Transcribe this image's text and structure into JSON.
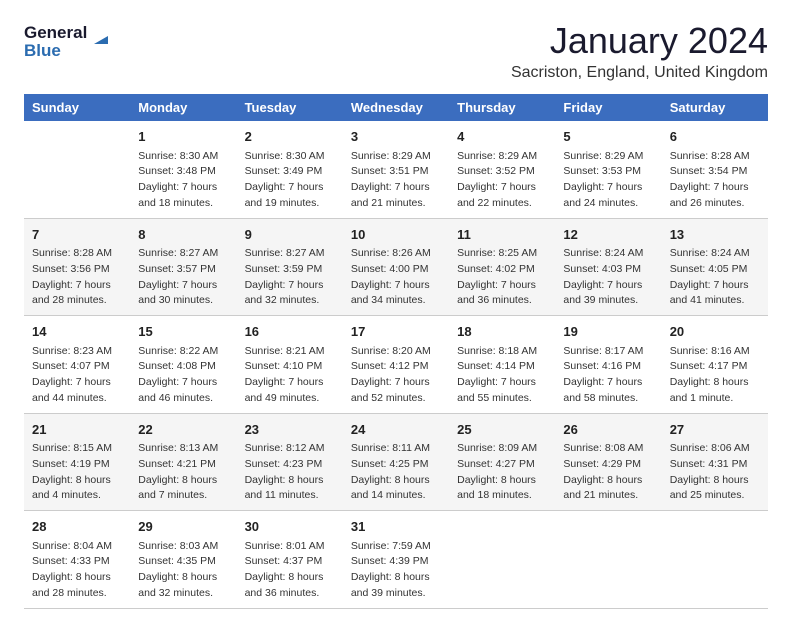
{
  "header": {
    "logo_line1": "General",
    "logo_line2": "Blue",
    "month": "January 2024",
    "location": "Sacriston, England, United Kingdom"
  },
  "weekdays": [
    "Sunday",
    "Monday",
    "Tuesday",
    "Wednesday",
    "Thursday",
    "Friday",
    "Saturday"
  ],
  "weeks": [
    [
      {
        "day": "",
        "info": ""
      },
      {
        "day": "1",
        "info": "Sunrise: 8:30 AM\nSunset: 3:48 PM\nDaylight: 7 hours\nand 18 minutes."
      },
      {
        "day": "2",
        "info": "Sunrise: 8:30 AM\nSunset: 3:49 PM\nDaylight: 7 hours\nand 19 minutes."
      },
      {
        "day": "3",
        "info": "Sunrise: 8:29 AM\nSunset: 3:51 PM\nDaylight: 7 hours\nand 21 minutes."
      },
      {
        "day": "4",
        "info": "Sunrise: 8:29 AM\nSunset: 3:52 PM\nDaylight: 7 hours\nand 22 minutes."
      },
      {
        "day": "5",
        "info": "Sunrise: 8:29 AM\nSunset: 3:53 PM\nDaylight: 7 hours\nand 24 minutes."
      },
      {
        "day": "6",
        "info": "Sunrise: 8:28 AM\nSunset: 3:54 PM\nDaylight: 7 hours\nand 26 minutes."
      }
    ],
    [
      {
        "day": "7",
        "info": "Sunrise: 8:28 AM\nSunset: 3:56 PM\nDaylight: 7 hours\nand 28 minutes."
      },
      {
        "day": "8",
        "info": "Sunrise: 8:27 AM\nSunset: 3:57 PM\nDaylight: 7 hours\nand 30 minutes."
      },
      {
        "day": "9",
        "info": "Sunrise: 8:27 AM\nSunset: 3:59 PM\nDaylight: 7 hours\nand 32 minutes."
      },
      {
        "day": "10",
        "info": "Sunrise: 8:26 AM\nSunset: 4:00 PM\nDaylight: 7 hours\nand 34 minutes."
      },
      {
        "day": "11",
        "info": "Sunrise: 8:25 AM\nSunset: 4:02 PM\nDaylight: 7 hours\nand 36 minutes."
      },
      {
        "day": "12",
        "info": "Sunrise: 8:24 AM\nSunset: 4:03 PM\nDaylight: 7 hours\nand 39 minutes."
      },
      {
        "day": "13",
        "info": "Sunrise: 8:24 AM\nSunset: 4:05 PM\nDaylight: 7 hours\nand 41 minutes."
      }
    ],
    [
      {
        "day": "14",
        "info": "Sunrise: 8:23 AM\nSunset: 4:07 PM\nDaylight: 7 hours\nand 44 minutes."
      },
      {
        "day": "15",
        "info": "Sunrise: 8:22 AM\nSunset: 4:08 PM\nDaylight: 7 hours\nand 46 minutes."
      },
      {
        "day": "16",
        "info": "Sunrise: 8:21 AM\nSunset: 4:10 PM\nDaylight: 7 hours\nand 49 minutes."
      },
      {
        "day": "17",
        "info": "Sunrise: 8:20 AM\nSunset: 4:12 PM\nDaylight: 7 hours\nand 52 minutes."
      },
      {
        "day": "18",
        "info": "Sunrise: 8:18 AM\nSunset: 4:14 PM\nDaylight: 7 hours\nand 55 minutes."
      },
      {
        "day": "19",
        "info": "Sunrise: 8:17 AM\nSunset: 4:16 PM\nDaylight: 7 hours\nand 58 minutes."
      },
      {
        "day": "20",
        "info": "Sunrise: 8:16 AM\nSunset: 4:17 PM\nDaylight: 8 hours\nand 1 minute."
      }
    ],
    [
      {
        "day": "21",
        "info": "Sunrise: 8:15 AM\nSunset: 4:19 PM\nDaylight: 8 hours\nand 4 minutes."
      },
      {
        "day": "22",
        "info": "Sunrise: 8:13 AM\nSunset: 4:21 PM\nDaylight: 8 hours\nand 7 minutes."
      },
      {
        "day": "23",
        "info": "Sunrise: 8:12 AM\nSunset: 4:23 PM\nDaylight: 8 hours\nand 11 minutes."
      },
      {
        "day": "24",
        "info": "Sunrise: 8:11 AM\nSunset: 4:25 PM\nDaylight: 8 hours\nand 14 minutes."
      },
      {
        "day": "25",
        "info": "Sunrise: 8:09 AM\nSunset: 4:27 PM\nDaylight: 8 hours\nand 18 minutes."
      },
      {
        "day": "26",
        "info": "Sunrise: 8:08 AM\nSunset: 4:29 PM\nDaylight: 8 hours\nand 21 minutes."
      },
      {
        "day": "27",
        "info": "Sunrise: 8:06 AM\nSunset: 4:31 PM\nDaylight: 8 hours\nand 25 minutes."
      }
    ],
    [
      {
        "day": "28",
        "info": "Sunrise: 8:04 AM\nSunset: 4:33 PM\nDaylight: 8 hours\nand 28 minutes."
      },
      {
        "day": "29",
        "info": "Sunrise: 8:03 AM\nSunset: 4:35 PM\nDaylight: 8 hours\nand 32 minutes."
      },
      {
        "day": "30",
        "info": "Sunrise: 8:01 AM\nSunset: 4:37 PM\nDaylight: 8 hours\nand 36 minutes."
      },
      {
        "day": "31",
        "info": "Sunrise: 7:59 AM\nSunset: 4:39 PM\nDaylight: 8 hours\nand 39 minutes."
      },
      {
        "day": "",
        "info": ""
      },
      {
        "day": "",
        "info": ""
      },
      {
        "day": "",
        "info": ""
      }
    ]
  ]
}
